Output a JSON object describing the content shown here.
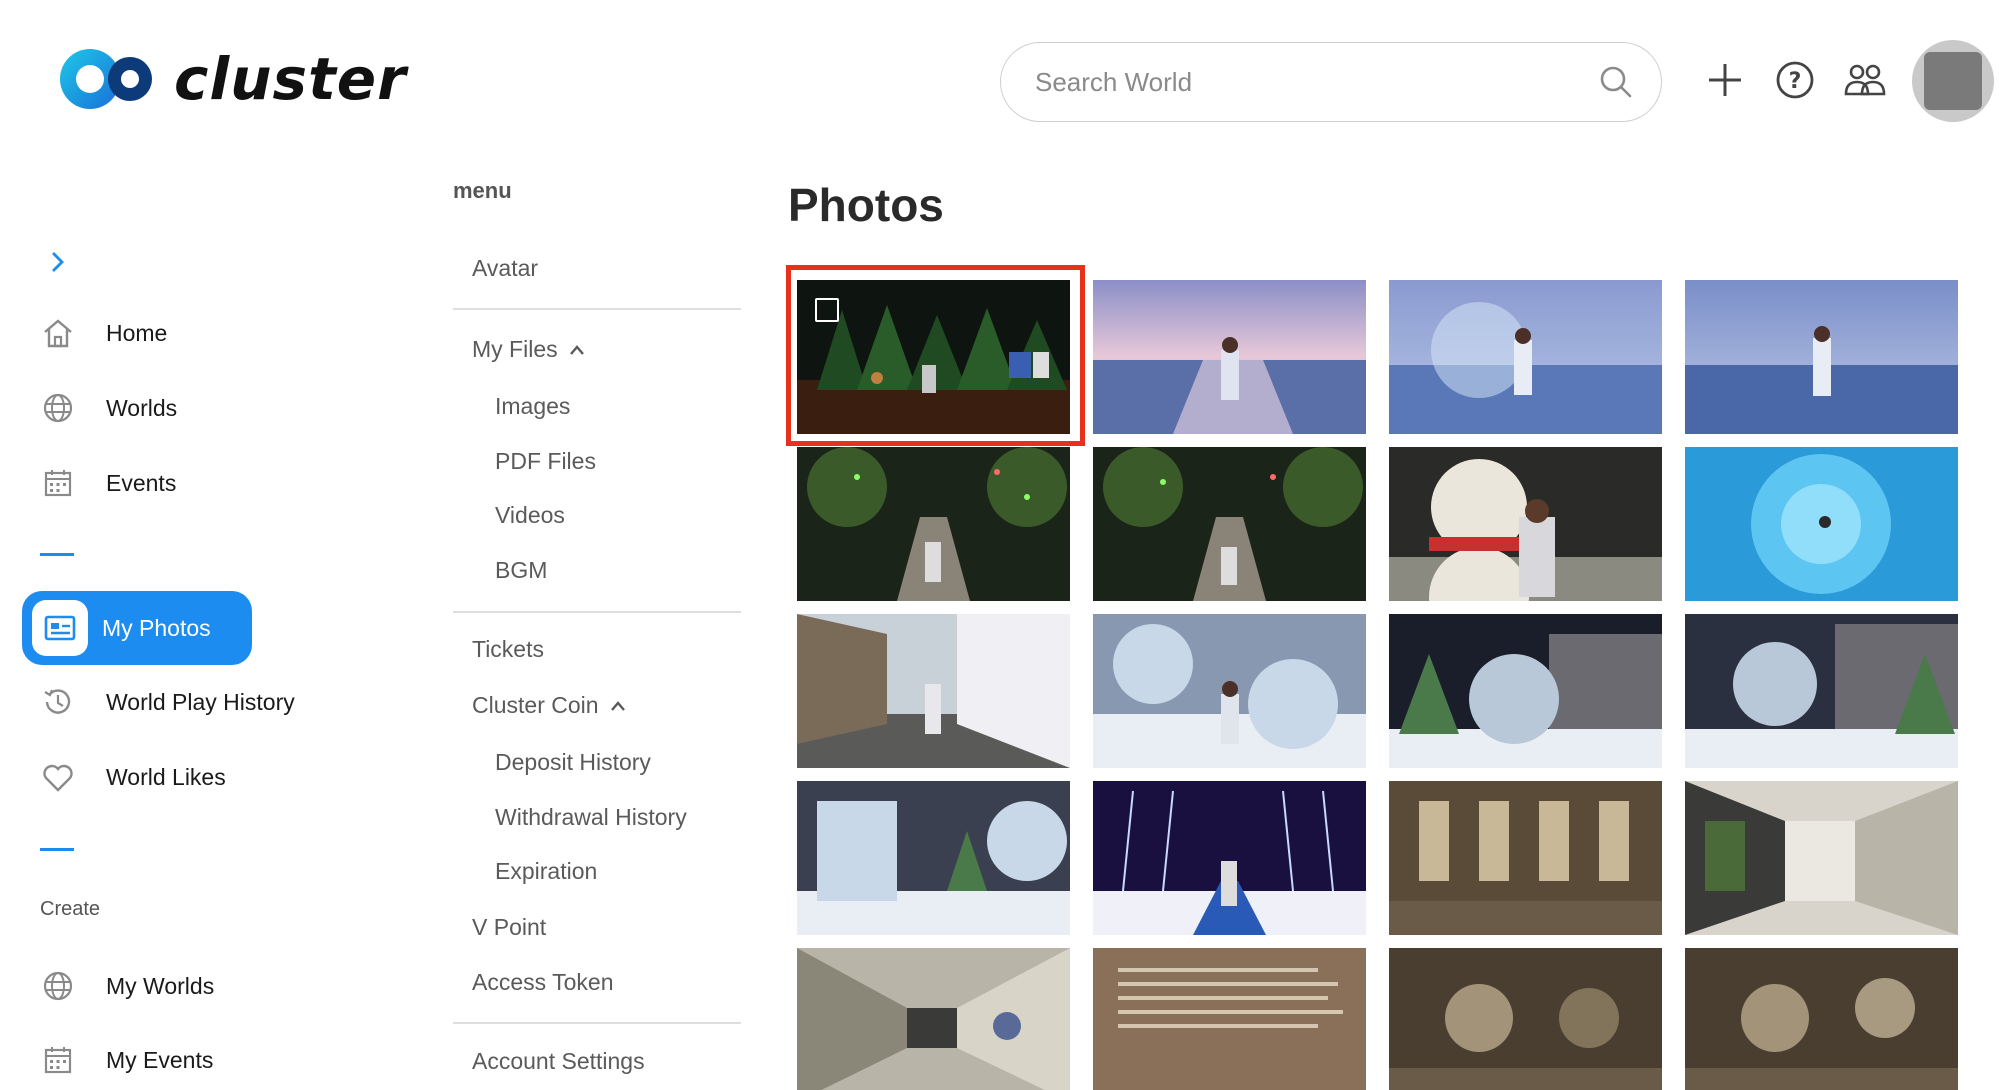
{
  "app": {
    "logo_text": "cluster"
  },
  "header": {
    "search_placeholder": "Search World",
    "icons": [
      "plus-icon",
      "help-icon",
      "friends-icon"
    ]
  },
  "nav": {
    "items": [
      {
        "label": "Home",
        "icon": "home-icon"
      },
      {
        "label": "Worlds",
        "icon": "globe-icon"
      },
      {
        "label": "Events",
        "icon": "calendar-icon"
      },
      {
        "label": "My Photos",
        "icon": "photo-icon",
        "active": true
      },
      {
        "label": "World Play History",
        "icon": "history-icon"
      },
      {
        "label": "World Likes",
        "icon": "heart-icon"
      }
    ],
    "create_label": "Create",
    "create_items": [
      {
        "label": "My Worlds",
        "icon": "globe-icon"
      },
      {
        "label": "My Events",
        "icon": "calendar-icon"
      }
    ]
  },
  "menu": {
    "title": "menu",
    "avatar": "Avatar",
    "my_files": "My Files",
    "files": [
      "Images",
      "PDF Files",
      "Videos",
      "BGM"
    ],
    "tickets": "Tickets",
    "cluster_coin": "Cluster Coin",
    "coin_items": [
      "Deposit History",
      "Withdrawal History",
      "Expiration"
    ],
    "v_point": "V Point",
    "access_token": "Access Token",
    "account_settings": "Account Settings"
  },
  "photos": {
    "title": "Photos",
    "colors": {
      "accent": "#1c8cf0",
      "selection": "#e8311a"
    }
  }
}
